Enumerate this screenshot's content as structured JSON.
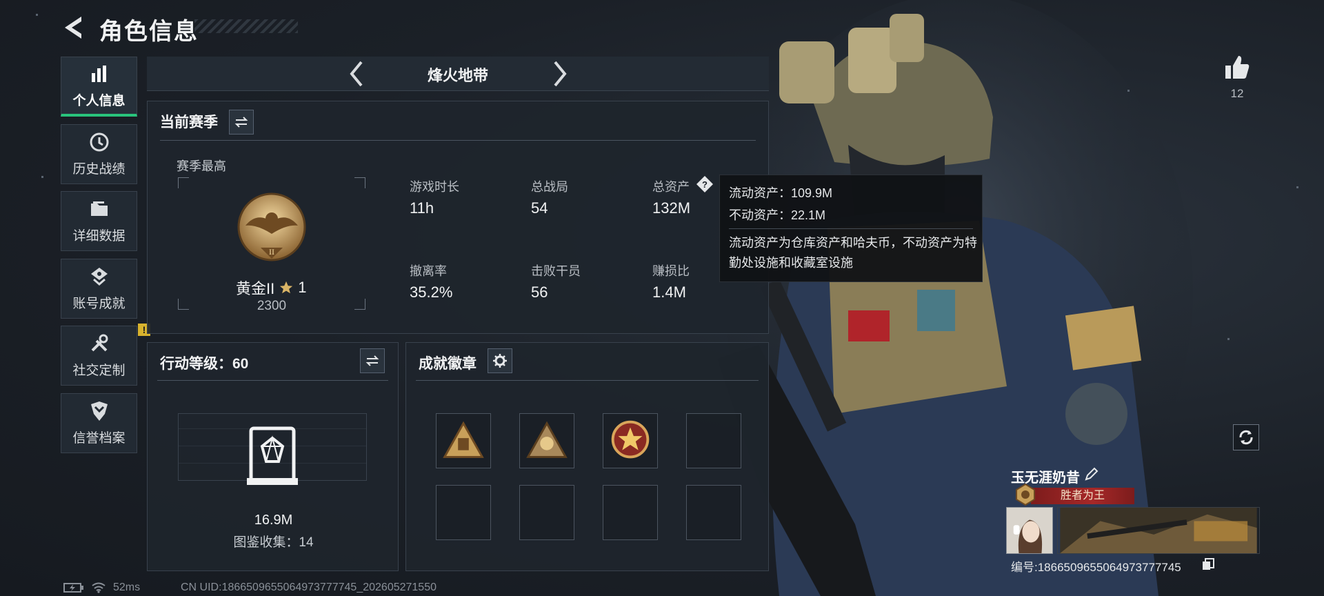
{
  "header": {
    "title": "角色信息"
  },
  "sidebar": {
    "items": [
      {
        "label": "个人信息",
        "icon": "bar-chart-icon"
      },
      {
        "label": "历史战绩",
        "icon": "clock-icon"
      },
      {
        "label": "详细数据",
        "icon": "folder-icon"
      },
      {
        "label": "账号成就",
        "icon": "achievement-icon"
      },
      {
        "label": "社交定制",
        "icon": "tools-icon",
        "badge": "!"
      },
      {
        "label": "信誉档案",
        "icon": "shield-icon"
      }
    ]
  },
  "game_tab": {
    "title": "烽火地带"
  },
  "season": {
    "heading": "当前赛季",
    "best_label": "赛季最高",
    "rank_name": "黄金II",
    "rank_stars": "1",
    "rank_points": "2300",
    "stats": [
      {
        "label": "游戏时长",
        "value": "11h"
      },
      {
        "label": "总战局",
        "value": "54"
      },
      {
        "label": "总资产",
        "value": "132M"
      },
      {
        "label": "撤离率",
        "value": "35.2%"
      },
      {
        "label": "击败干员",
        "value": "56"
      },
      {
        "label": "赚损比",
        "value": "1.4M"
      }
    ]
  },
  "tooltip": {
    "liquid": "流动资产：109.9M",
    "fixed": "不动资产：22.1M",
    "description": "流动资产为仓库资产和哈夫币，不动资产为特勤处设施和收藏室设施"
  },
  "action_level": {
    "heading": "行动等级：60",
    "value": "16.9M",
    "collection": "图鉴收集：14"
  },
  "badges": {
    "heading": "成就徽章"
  },
  "likes": {
    "count": "12"
  },
  "player": {
    "name": "玉无涯奶昔",
    "title": "胜者为王",
    "id": "编号:1866509655064973777745"
  },
  "status": {
    "ping": "52ms",
    "uid": "CN UID:1866509655064973777745_202605271550"
  },
  "colors": {
    "accent_green": "#29c47c",
    "title_red": "#a62828",
    "badge_yellow": "#d8b32e"
  }
}
